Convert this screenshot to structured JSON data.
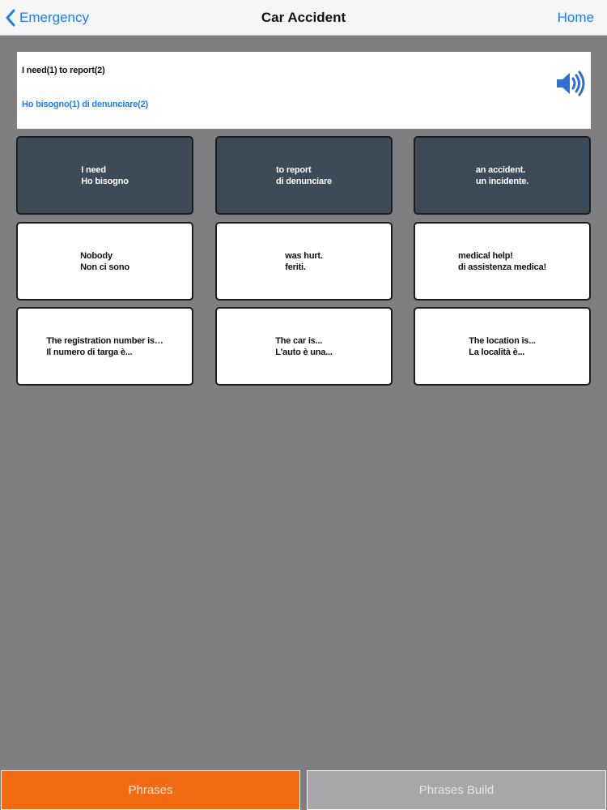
{
  "navbar": {
    "back_label": "Emergency",
    "title": "Car Accident",
    "home_label": "Home"
  },
  "sentence": {
    "english": "I need(1) to report(2)",
    "italian": "Ho bisogno(1) di denunciare(2)",
    "speaker_icon": "speaker-icon"
  },
  "cards": [
    {
      "en": "I need",
      "it": "Ho bisogno",
      "selected": true
    },
    {
      "en": "to report",
      "it": "di denunciare",
      "selected": true
    },
    {
      "en": "an accident.",
      "it": "un incidente.",
      "selected": true
    },
    {
      "en": "Nobody",
      "it": "Non ci sono",
      "selected": false
    },
    {
      "en": "was hurt.",
      "it": "feriti.",
      "selected": false
    },
    {
      "en": "medical help!",
      "it": "di assistenza medica!",
      "selected": false
    },
    {
      "en": "The registration number is…",
      "it": "Il numero di targa è...",
      "selected": false
    },
    {
      "en": "The car is...",
      "it": "L'auto è una...",
      "selected": false
    },
    {
      "en": "The location is...",
      "it": "La località è...",
      "selected": false
    }
  ],
  "tabs": {
    "phrases": "Phrases",
    "phrases_build": "Phrases Build"
  },
  "colors": {
    "accent_blue": "#1a7ff3",
    "active_tab": "#f26a12",
    "inactive_tab": "#a7a6a9",
    "selected_card": "#3d4a57",
    "background": "#7f7e81"
  }
}
